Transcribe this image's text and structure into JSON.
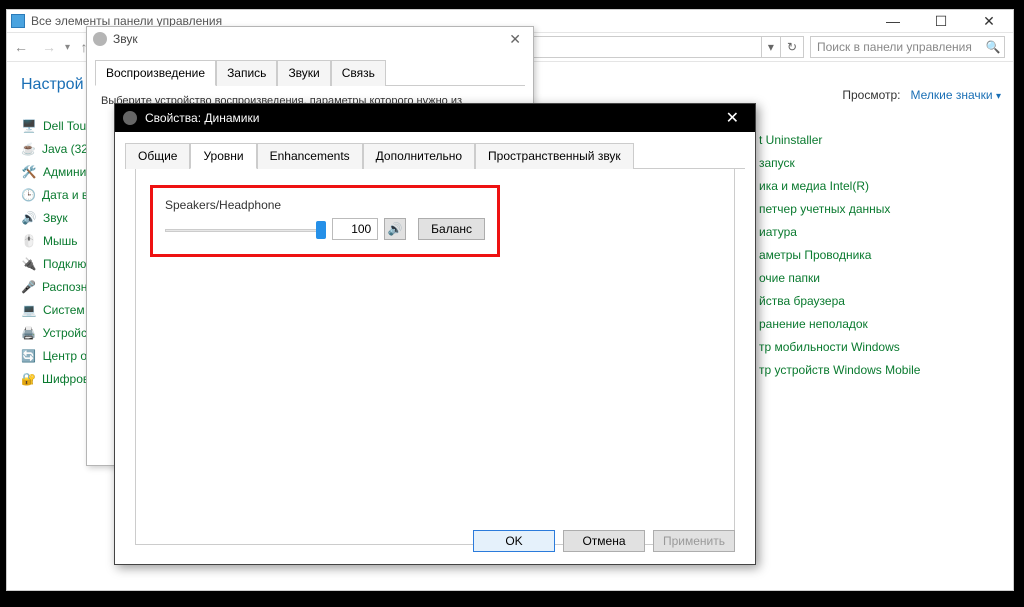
{
  "controlPanel": {
    "title": "Все элементы панели управления",
    "searchPlaceholder": "Поиск в панели управления",
    "heading": "Настрой",
    "viewLabel": "Просмотр:",
    "viewValue": "Мелкие значки",
    "leftItems": [
      "Dell Tou",
      "Java (32",
      "Админи",
      "Дата и в",
      "Звук",
      "Мышь",
      "Подклю",
      "Распозн",
      "Систем",
      "Устройс",
      "Центр о",
      "Шифров"
    ],
    "rightItems": [
      "t Uninstaller",
      "запуск",
      "ика и медиа Intel(R)",
      "петчер учетных данных",
      "иатура",
      "аметры Проводника",
      "очие папки",
      "йства браузера",
      "ранение неполадок",
      "тр мобильности Windows",
      "тр устройств Windows Mobile"
    ]
  },
  "sound": {
    "title": "Звук",
    "tabs": [
      "Воспроизведение",
      "Запись",
      "Звуки",
      "Связь"
    ],
    "activeTab": 0,
    "hint": "Выберите устройство воспроизведения, параметры которого нужно из"
  },
  "properties": {
    "title": "Свойства: Динамики",
    "tabs": [
      "Общие",
      "Уровни",
      "Enhancements",
      "Дополнительно",
      "Пространственный звук"
    ],
    "activeTab": 1,
    "deviceLabel": "Speakers/Headphone",
    "volume": "100",
    "balanceLabel": "Баланс",
    "buttons": {
      "ok": "OK",
      "cancel": "Отмена",
      "apply": "Применить"
    }
  }
}
